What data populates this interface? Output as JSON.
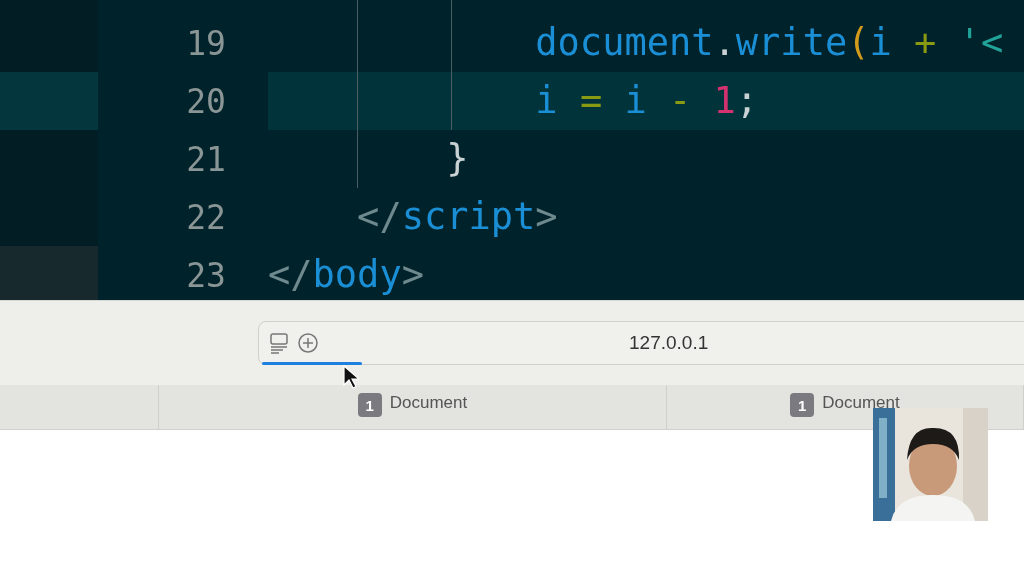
{
  "editor": {
    "lines": [
      {
        "number": "19",
        "current": false,
        "tokens": [
          {
            "text": "            document",
            "kind": "ident"
          },
          {
            "text": ".",
            "kind": "punct"
          },
          {
            "text": "write",
            "kind": "ident"
          },
          {
            "text": "(",
            "kind": "paren"
          },
          {
            "text": "i ",
            "kind": "ident"
          },
          {
            "text": "+ ",
            "kind": "op"
          },
          {
            "text": "'<",
            "kind": "string"
          }
        ]
      },
      {
        "number": "20",
        "current": true,
        "tokens": [
          {
            "text": "            i ",
            "kind": "ident"
          },
          {
            "text": "= ",
            "kind": "op"
          },
          {
            "text": "i ",
            "kind": "ident"
          },
          {
            "text": "- ",
            "kind": "op"
          },
          {
            "text": "1",
            "kind": "number"
          },
          {
            "text": ";",
            "kind": "punct"
          }
        ]
      },
      {
        "number": "21",
        "current": false,
        "tokens": [
          {
            "text": "        }",
            "kind": "punct"
          }
        ]
      },
      {
        "number": "22",
        "current": false,
        "tokens": [
          {
            "text": "    </",
            "kind": "bracket"
          },
          {
            "text": "script",
            "kind": "tag"
          },
          {
            "text": ">",
            "kind": "bracket"
          }
        ]
      },
      {
        "number": "23",
        "current": false,
        "tokens": [
          {
            "text": "</",
            "kind": "bracket"
          },
          {
            "text": "body",
            "kind": "tag"
          },
          {
            "text": ">",
            "kind": "bracket"
          }
        ]
      }
    ]
  },
  "browser": {
    "address": "127.0.0.1",
    "load_progress": {
      "level": 0.13
    },
    "tabs": [
      {
        "badge": "1",
        "title": "Document",
        "selected": false
      },
      {
        "badge": "1",
        "title": "Document",
        "selected": false
      }
    ]
  }
}
